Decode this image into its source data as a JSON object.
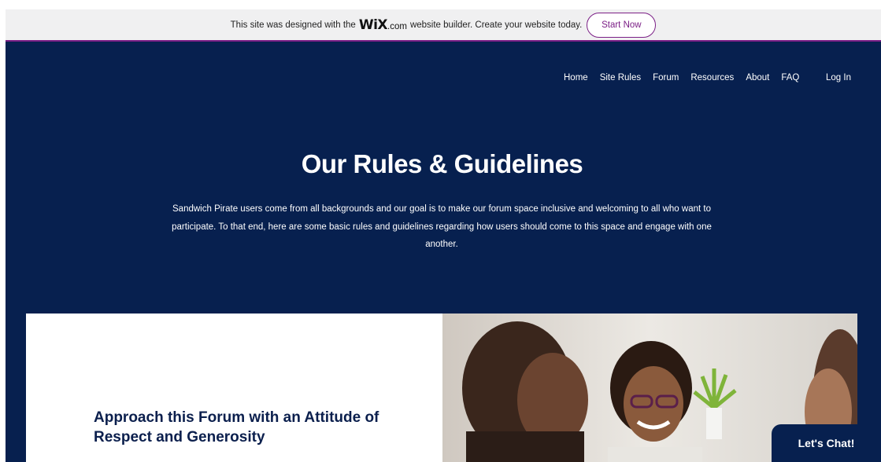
{
  "banner": {
    "text_before": "This site was designed with the",
    "logo": "WiX",
    "logo_suffix": ".com",
    "text_after": "website builder. Create your website today.",
    "cta": "Start Now"
  },
  "nav": {
    "items": [
      "Home",
      "Site Rules",
      "Forum",
      "Resources",
      "About",
      "FAQ"
    ],
    "login": "Log In"
  },
  "hero": {
    "title": "Our Rules & Guidelines",
    "intro": "Sandwich Pirate users come from all backgrounds and our goal is to make our forum space inclusive and welcoming to all who want to participate. To that end, here are some basic rules and guidelines regarding how users should come to this space and engage with one another."
  },
  "section": {
    "heading": "Approach this Forum with an Attitude of Respect and Generosity"
  },
  "chat": {
    "label": "Let's Chat!"
  },
  "colors": {
    "navy": "#07204f",
    "wix_purple": "#7b1f86",
    "heading_navy": "#0b1f4d"
  }
}
